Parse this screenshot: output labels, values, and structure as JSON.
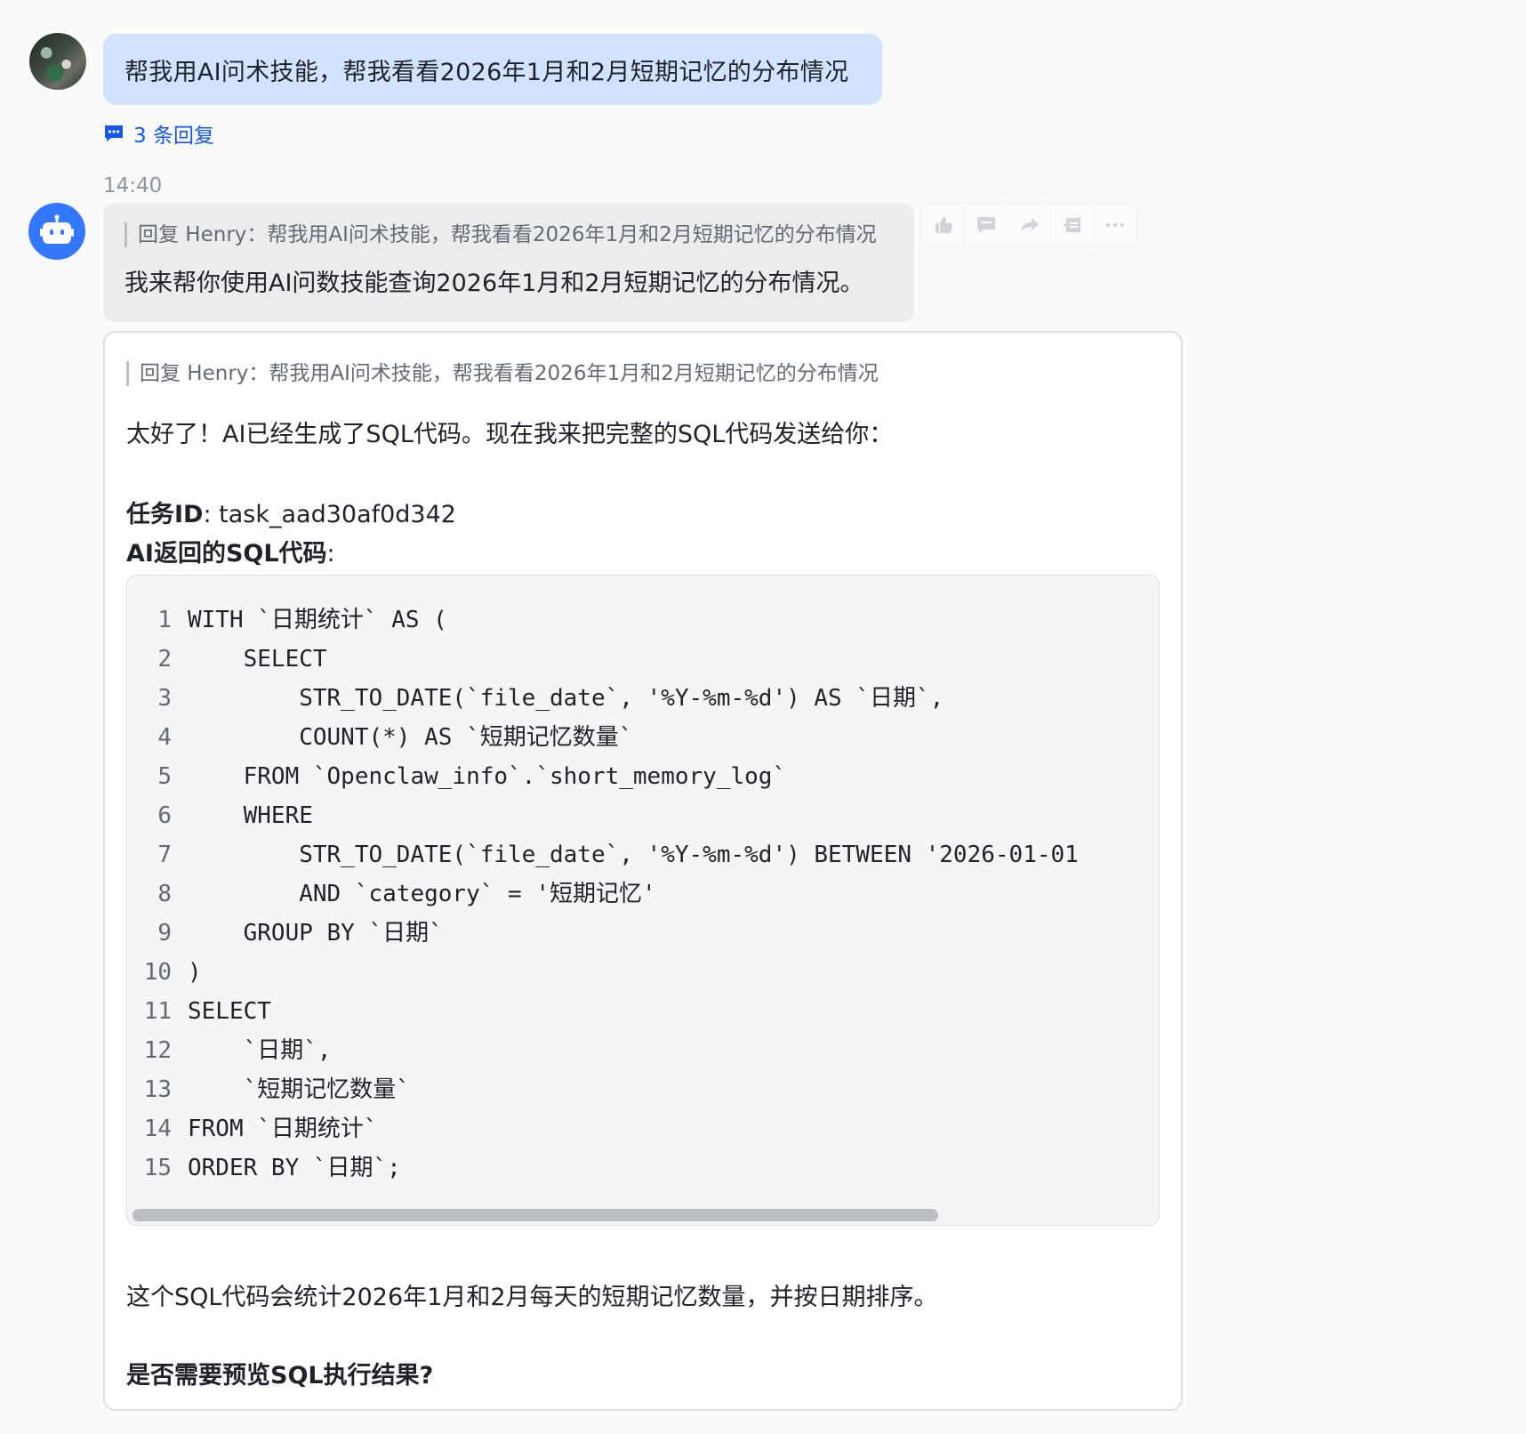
{
  "user_message": {
    "text": "帮我用AI问术技能，帮我看看2026年1月和2月短期记忆的分布情况",
    "replies_label": "3 条回复"
  },
  "timestamp": "14:40",
  "bot_message": {
    "quote": "回复 Henry：帮我用AI问术技能，帮我看看2026年1月和2月短期记忆的分布情况",
    "text": "我来帮你使用AI问数技能查询2026年1月和2月短期记忆的分布情况。"
  },
  "toolbar": {
    "icons": [
      "thumbs-up-icon",
      "comment-icon",
      "forward-icon",
      "quote-icon",
      "more-icon"
    ]
  },
  "card": {
    "quote": "回复 Henry：帮我用AI问术技能，帮我看看2026年1月和2月短期记忆的分布情况",
    "intro": "太好了！AI已经生成了SQL代码。现在我来把完整的SQL代码发送给你：",
    "task_label": "任务ID",
    "task_value": ": task_aad30af0d342",
    "sql_label": "AI返回的SQL代码",
    "sql_suffix": ":",
    "code_lines": [
      {
        "n": "1",
        "code": "WITH `日期统计` AS ("
      },
      {
        "n": "2",
        "code": "    SELECT"
      },
      {
        "n": "3",
        "code": "        STR_TO_DATE(`file_date`, '%Y-%m-%d') AS `日期`,"
      },
      {
        "n": "4",
        "code": "        COUNT(*) AS `短期记忆数量`"
      },
      {
        "n": "5",
        "code": "    FROM `Openclaw_info`.`short_memory_log`"
      },
      {
        "n": "6",
        "code": "    WHERE"
      },
      {
        "n": "7",
        "code": "        STR_TO_DATE(`file_date`, '%Y-%m-%d') BETWEEN '2026-01-01"
      },
      {
        "n": "8",
        "code": "        AND `category` = '短期记忆'"
      },
      {
        "n": "9",
        "code": "    GROUP BY `日期`"
      },
      {
        "n": "10",
        "code": ")"
      },
      {
        "n": "11",
        "code": "SELECT"
      },
      {
        "n": "12",
        "code": "    `日期`,"
      },
      {
        "n": "13",
        "code": "    `短期记忆数量`"
      },
      {
        "n": "14",
        "code": "FROM `日期统计`"
      },
      {
        "n": "15",
        "code": "ORDER BY `日期`;"
      }
    ],
    "summary": "这个SQL代码会统计2026年1月和2月每天的短期记忆数量，并按日期排序。",
    "question": "是否需要预览SQL执行结果?"
  }
}
